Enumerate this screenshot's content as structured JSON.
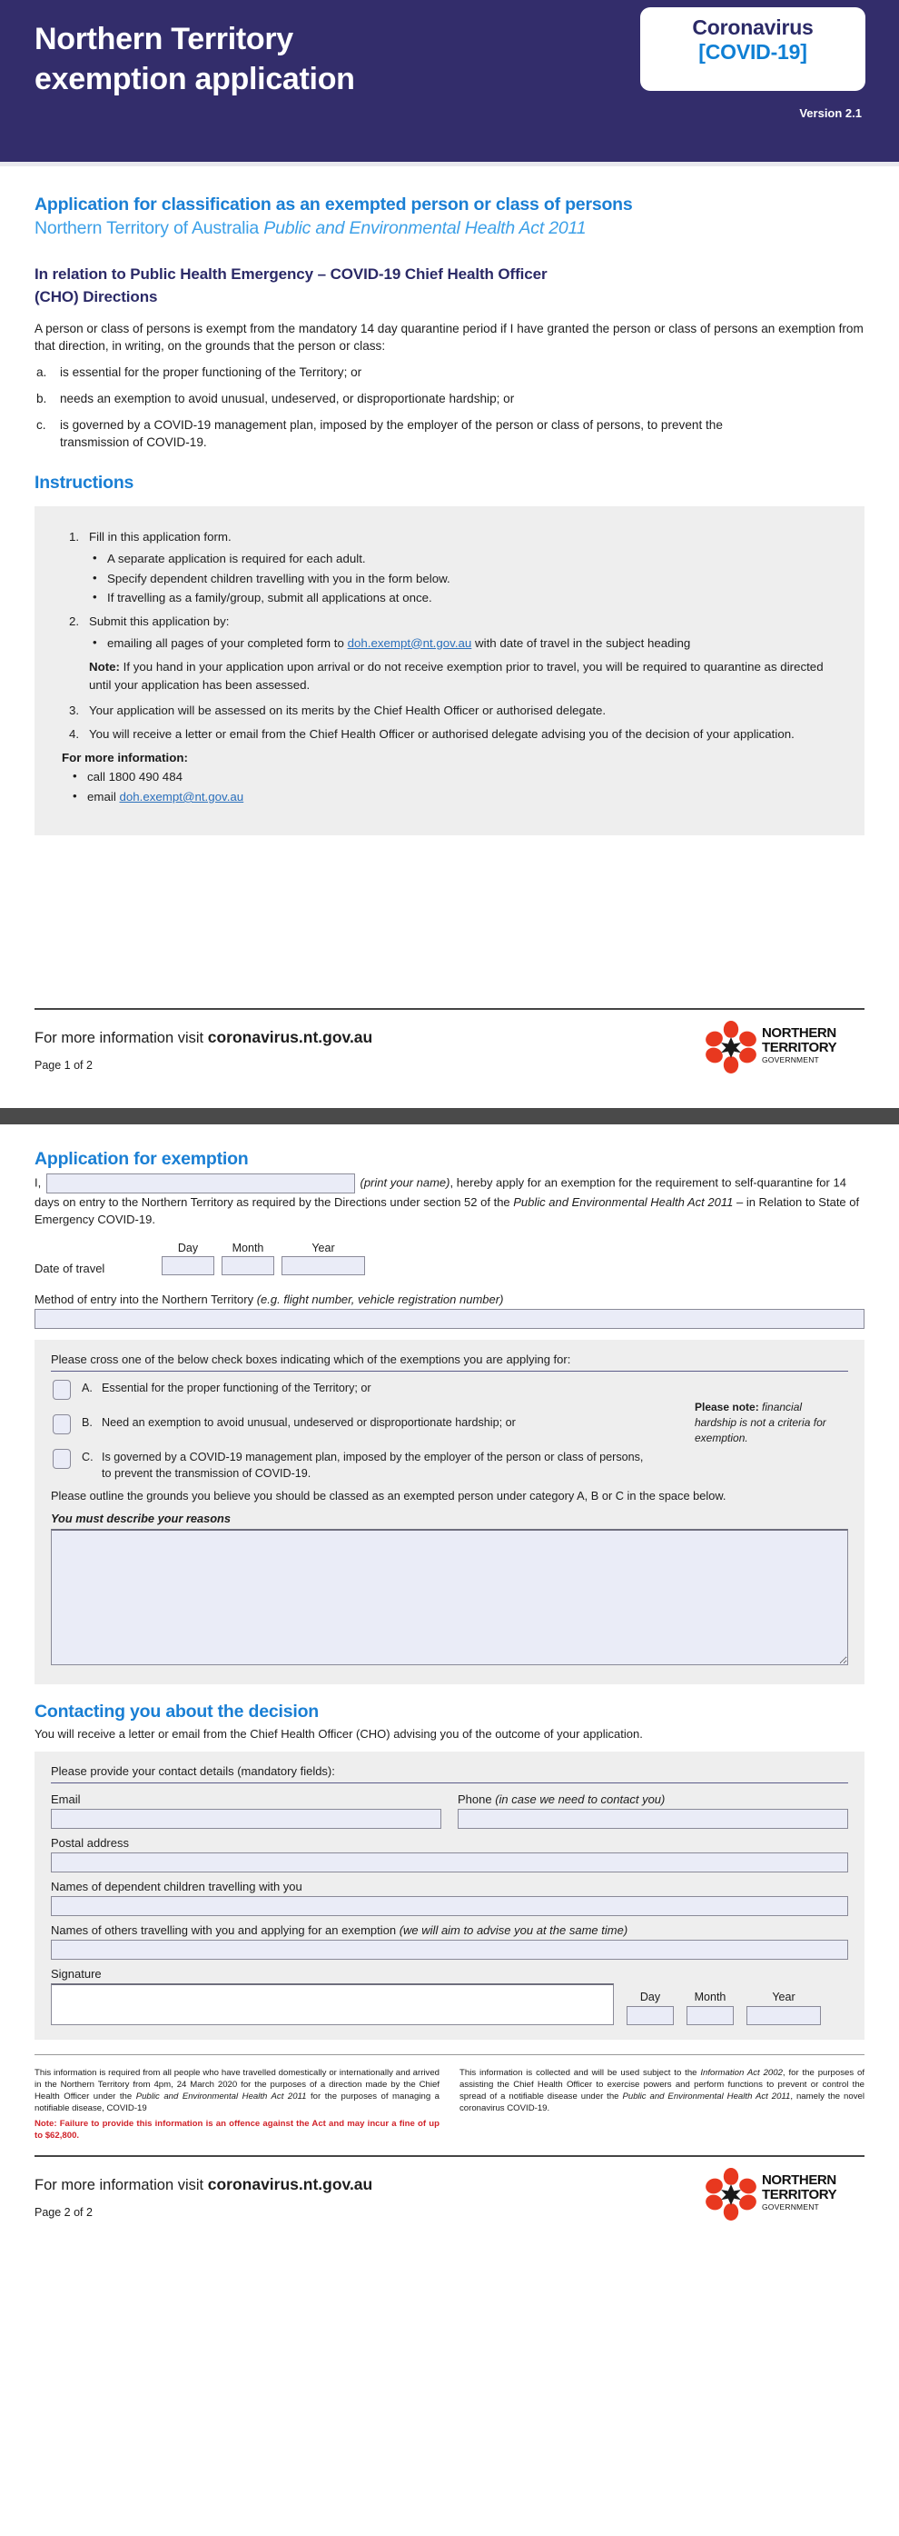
{
  "header": {
    "title_line1": "Northern Territory",
    "title_line2": "exemption application",
    "badge_line1": "Coronavirus",
    "badge_line2": "[COVID-19]",
    "version": "Version 2.1",
    "banner_color": "#332d6b",
    "badge_blue": "#0f7fd4"
  },
  "page1": {
    "heading_blue": "Application for classification as an exempted person or class of persons",
    "subheading_prefix": "Northern Territory of Australia ",
    "subheading_italic": "Public and Environmental Health Act 2011",
    "navy_heading_line1": "In relation to Public Health Emergency – COVID-19 Chief Health Officer",
    "navy_heading_line2": "(CHO) Directions",
    "intro": "A person or class of persons is exempt from the mandatory 14 day quarantine period if I have granted the person or class of persons an exemption from that direction, in writing, on the grounds that the person or class:",
    "grounds": [
      {
        "mark": "a.",
        "text": "is essential for the proper functioning of the Territory; or"
      },
      {
        "mark": "b.",
        "text": "needs an exemption to avoid unusual, undeserved, or disproportionate hardship; or"
      },
      {
        "mark": "c.",
        "text": "is governed by a COVID-19 management plan, imposed by the employer of the person or class of persons, to prevent the transmission of COVID-19."
      }
    ],
    "instructions_heading": "Instructions",
    "step1_num": "1.",
    "step1_text": "Fill in this application form.",
    "step1_bullets": [
      "A separate application is required for each adult.",
      "Specify dependent children travelling with you in the form below.",
      "If travelling as a family/group, submit all applications at once."
    ],
    "step2_num": "2.",
    "step2_text": "Submit this application by:",
    "step2_bullet_pre": "emailing all pages of your completed form to ",
    "step2_bullet_email": "doh.exempt@nt.gov.au",
    "step2_bullet_post": " with date of travel in the subject heading",
    "note_label": "Note:",
    "note_text": " If you hand in your application upon arrival or do not receive exemption prior to travel, you will be required to quarantine as directed until your application has been assessed.",
    "step3_num": "3.",
    "step3_text": "Your application will be assessed on its merits by the Chief Health Officer or authorised delegate.",
    "step4_num": "4.",
    "step4_text": "You will receive a letter or email from the Chief Health Officer or authorised delegate advising you of the decision of your application.",
    "more_info_label": "For more information:",
    "more_info_call": "call 1800 490 484",
    "more_info_email_pre": "email ",
    "more_info_email": "doh.exempt@nt.gov.au"
  },
  "footer": {
    "visit_prefix": "For more information visit ",
    "visit_url": "coronavirus.nt.gov.au",
    "page1_num": "Page 1 of 2",
    "page2_num": "Page 2 of 2",
    "logo_line1": "NORTHERN",
    "logo_line2": "TERRITORY",
    "logo_line3": "GOVERNMENT",
    "logo_color": "#e8381f"
  },
  "page2": {
    "heading": "Application for exemption",
    "decl_prefix": "I,",
    "decl_name_placeholder": "",
    "decl_italic1": "(print your name)",
    "decl_mid": ", hereby apply for an exemption for the requirement to self-quarantine for 14 days on entry to the Northern Territory as required by the Directions under section 52 of the ",
    "decl_italic2": "Public and Environmental Health Act 2011",
    "decl_end": " – in Relation to State of Emergency COVID-19.",
    "date_of_travel_label": "Date of travel",
    "day_label": "Day",
    "month_label": "Month",
    "year_label": "Year",
    "date_day_value": "",
    "date_month_value": "",
    "date_year_value": "",
    "method_label_plain": "Method of entry into the Northern Territory ",
    "method_label_italic": "(e.g. flight number, vehicle registration number)",
    "method_value": "",
    "checkbox_panel_head": "Please cross one of the below check boxes indicating which of the exemptions you are applying for:",
    "checkboxes": [
      {
        "letter": "A.",
        "text": "Essential for the proper functioning of the Territory; or",
        "checked": false
      },
      {
        "letter": "B.",
        "text": "Need an exemption to avoid unusual, undeserved or disproportionate hardship; or",
        "checked": false
      },
      {
        "letter": "C.",
        "text": "Is governed by a COVID-19 management plan, imposed by the employer of the person or class of persons, to prevent the transmission of COVID-19.",
        "checked": false
      }
    ],
    "please_note_label": "Please note:",
    "please_note_text": " financial hardship is not a criteria for exemption.",
    "outline_text": "Please outline the grounds you believe you should be classed as an exempted person under category A, B or C  in the space below.",
    "must_describe": "You must describe your reasons",
    "reasons_value": "",
    "contact_heading": "Contacting you about the decision",
    "contact_intro": "You will receive a letter or email from the Chief Health Officer (CHO) advising you of the outcome of your application.",
    "contact_panel_head": "Please provide your contact details (mandatory fields):",
    "email_label": "Email",
    "email_value": "",
    "phone_label_plain": "Phone ",
    "phone_label_italic": "(in case we need to contact you)",
    "phone_value": "",
    "postal_label": "Postal address",
    "postal_value": "",
    "children_label": "Names of dependent children travelling with you",
    "children_value": "",
    "others_label_plain": "Names of others travelling with you and applying for an exemption ",
    "others_label_italic": "(we will aim to advise you at the same time)",
    "others_value": "",
    "signature_label": "Signature",
    "signature_value": "",
    "sig_day_value": "",
    "sig_month_value": "",
    "sig_year_value": ""
  },
  "fineprint": {
    "left_part1": "This information is required from all people who have travelled domestically or internationally and arrived in the Northern Territory from 4pm, 24 March 2020 for the purposes of a direction made by the Chief Health Officer under the ",
    "left_italic": "Public and Environmental Health Act 2011",
    "left_part2": " for the purposes of managing a notifiable disease, COVID-19",
    "left_red": "Note:  Failure to provide this information is an offence against the Act and may incur a fine of up to $62,800.",
    "right_part1": "This information is collected and will be used subject to the ",
    "right_italic1": "Information Act 2002",
    "right_part2": ", for the purposes of assisting the Chief Health Officer to exercise powers and perform functions to prevent or control the spread of a notifiable disease under the ",
    "right_italic2": "Public and Environmental Health Act 2011",
    "right_part3": ", namely the novel coronavirus COVID-19.",
    "red_color": "#d1232a"
  }
}
